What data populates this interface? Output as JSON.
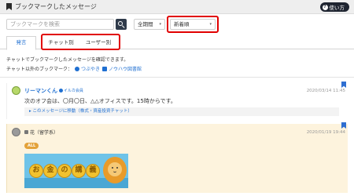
{
  "header": {
    "title": "ブックマークしたメッセージ",
    "help_label": "使い方",
    "help_icon": "question-icon"
  },
  "toolbar": {
    "search_placeholder": "ブックマークを検索",
    "period_select": {
      "selected": "全期間"
    },
    "sort_select": {
      "selected": "新着順"
    }
  },
  "tabs": [
    {
      "label": "発言",
      "active": true
    },
    {
      "label": "チャット別",
      "active": false
    },
    {
      "label": "ユーザー別",
      "active": false
    }
  ],
  "info": {
    "line1": "チャットでブックマークしたメッセージを確認できます。",
    "line2_prefix": "チャット以外のブックマーク：",
    "link1": "つぶやき",
    "link2": "ノウハウ図書館"
  },
  "messages": [
    {
      "author": "リーマンくん",
      "role": "イルカ会員",
      "time": "2020/03/14 11:45",
      "text": "次のオフ会は、〇月〇日、△△オフィスです。15時からです。",
      "jump_text": "▸ このメッセージに移動（株式・資産投資チャット）",
      "bookmarked": true
    },
    {
      "author": "花（留学系）",
      "time": "2020/01/19 19:44",
      "tag": "ALL",
      "banner_text": "お金の講義",
      "bookmarked": true
    }
  ],
  "colors": {
    "accent": "#1f6fd1",
    "highlight_box": "#e10000",
    "message_bg": "#fdf3dd",
    "tag": "#e3a23a"
  }
}
